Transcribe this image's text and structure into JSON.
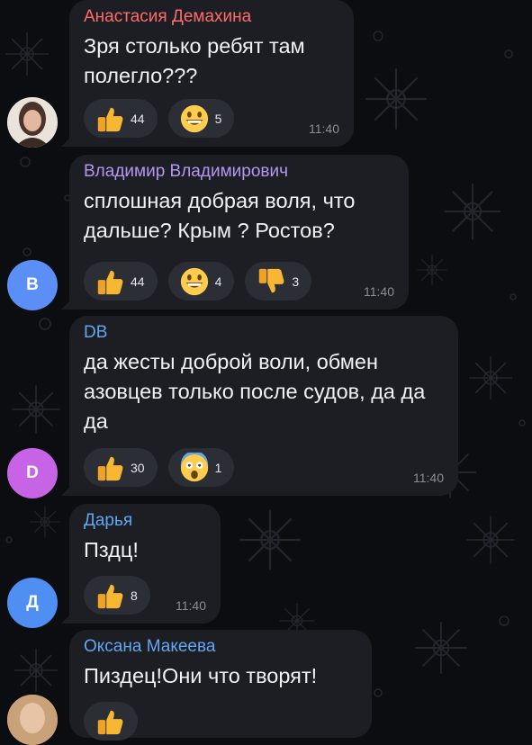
{
  "messages": [
    {
      "sender": "Анастасия Демахина",
      "sender_color": "#ff6b6b",
      "text": "Зря столько ребят там полегло???",
      "time": "11:40",
      "avatar": {
        "type": "photo"
      },
      "reactions": [
        {
          "emoji": "thumbs-up",
          "count": "44"
        },
        {
          "emoji": "grinning-face",
          "count": "5"
        }
      ]
    },
    {
      "sender": "Владимир Владимирович",
      "sender_color": "#b497f2",
      "text": "сплошная добрая воля, что дальше? Крым ? Ростов?",
      "time": "11:40",
      "avatar": {
        "type": "letter",
        "letter": "B",
        "color": "#5b8ff5"
      },
      "reactions": [
        {
          "emoji": "thumbs-up",
          "count": "44"
        },
        {
          "emoji": "grinning-face",
          "count": "4"
        },
        {
          "emoji": "thumbs-down",
          "count": "3"
        }
      ]
    },
    {
      "sender": "DB",
      "sender_color": "#63a6f2",
      "text": "да жесты доброй воли, обмен азовцев только после судов, да да да",
      "time": "11:40",
      "avatar": {
        "type": "letter",
        "letter": "D",
        "color": "#c764e6"
      },
      "reactions": [
        {
          "emoji": "thumbs-up",
          "count": "30"
        },
        {
          "emoji": "screaming-face",
          "count": "1"
        }
      ]
    },
    {
      "sender": "Дарья",
      "sender_color": "#63a6f2",
      "text": "Пздц!",
      "time": "11:40",
      "avatar": {
        "type": "letter",
        "letter": "Д",
        "color": "#4f8ff2"
      },
      "reactions": [
        {
          "emoji": "thumbs-up",
          "count": "8"
        }
      ]
    },
    {
      "sender": "Оксана Макеева",
      "sender_color": "#63a6f2",
      "text": "Пиздец!Они что творят!",
      "time": "",
      "avatar": {
        "type": "photo"
      },
      "reactions": [
        {
          "emoji": "thumbs-up",
          "count": ""
        }
      ]
    }
  ]
}
